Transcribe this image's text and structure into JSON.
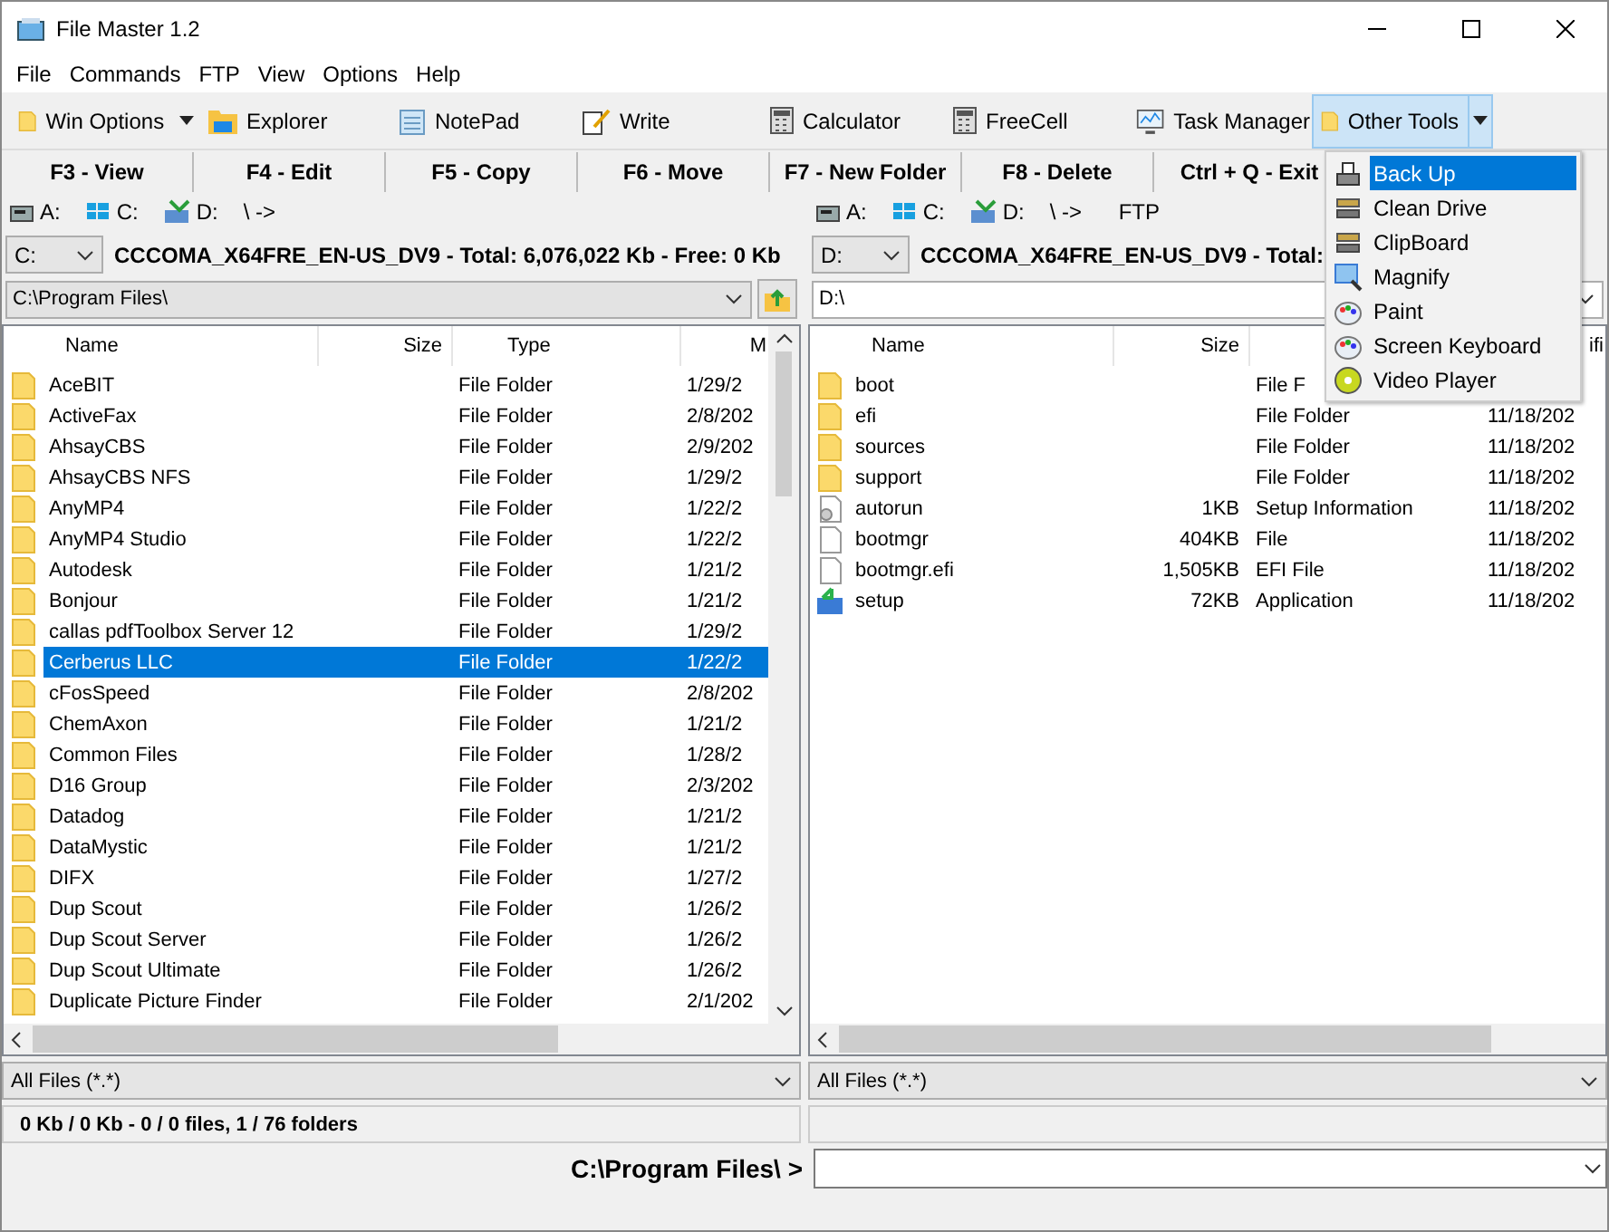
{
  "window": {
    "title": "File Master 1.2"
  },
  "menu": [
    "File",
    "Commands",
    "FTP",
    "View",
    "Options",
    "Help"
  ],
  "toolbar": [
    {
      "label": "Win Options",
      "dropdown": true,
      "selected": false
    },
    {
      "label": "Explorer",
      "dropdown": false,
      "selected": false
    },
    {
      "label": "NotePad",
      "dropdown": false,
      "selected": false
    },
    {
      "label": "Write",
      "dropdown": false,
      "selected": false
    },
    {
      "label": "Calculator",
      "dropdown": false,
      "selected": false
    },
    {
      "label": "FreeCell",
      "dropdown": false,
      "selected": false
    },
    {
      "label": "Task Manager",
      "dropdown": false,
      "selected": false
    },
    {
      "label": "Other Tools",
      "dropdown": true,
      "selected": true
    }
  ],
  "function_keys": [
    "F3 - View",
    "F4 - Edit",
    "F5 - Copy",
    "F6 - Move",
    "F7 - New Folder",
    "F8 - Delete",
    "Ctrl + Q - Exit"
  ],
  "panes": [
    {
      "drives": [
        "A:",
        "C:",
        "D:",
        "\\ ->"
      ],
      "drive_select": "C:",
      "volume_info": "CCCOMA_X64FRE_EN-US_DV9 - Total: 6,076,022 Kb - Free: 0 Kb",
      "path": "C:\\Program Files\\",
      "columns": [
        {
          "label": "Name"
        },
        {
          "label": "Size"
        },
        {
          "label": "Type"
        },
        {
          "label": "M"
        }
      ],
      "rows": [
        {
          "name": "AceBIT",
          "type": "File Folder",
          "modified": "1/29/2",
          "kind": "folder",
          "selected": false
        },
        {
          "name": "ActiveFax",
          "type": "File Folder",
          "modified": "2/8/202",
          "kind": "folder",
          "selected": false
        },
        {
          "name": "AhsayCBS",
          "type": "File Folder",
          "modified": "2/9/202",
          "kind": "folder",
          "selected": false
        },
        {
          "name": "AhsayCBS NFS",
          "type": "File Folder",
          "modified": "1/29/2",
          "kind": "folder",
          "selected": false
        },
        {
          "name": "AnyMP4",
          "type": "File Folder",
          "modified": "1/22/2",
          "kind": "folder",
          "selected": false
        },
        {
          "name": "AnyMP4 Studio",
          "type": "File Folder",
          "modified": "1/22/2",
          "kind": "folder",
          "selected": false
        },
        {
          "name": "Autodesk",
          "type": "File Folder",
          "modified": "1/21/2",
          "kind": "folder",
          "selected": false
        },
        {
          "name": "Bonjour",
          "type": "File Folder",
          "modified": "1/21/2",
          "kind": "folder",
          "selected": false
        },
        {
          "name": "callas pdfToolbox Server 12",
          "type": "File Folder",
          "modified": "1/29/2",
          "kind": "folder",
          "selected": false
        },
        {
          "name": "Cerberus LLC",
          "type": "File Folder",
          "modified": "1/22/2",
          "kind": "folder",
          "selected": true
        },
        {
          "name": "cFosSpeed",
          "type": "File Folder",
          "modified": "2/8/202",
          "kind": "folder",
          "selected": false
        },
        {
          "name": "ChemAxon",
          "type": "File Folder",
          "modified": "1/21/2",
          "kind": "folder",
          "selected": false
        },
        {
          "name": "Common Files",
          "type": "File Folder",
          "modified": "1/28/2",
          "kind": "folder",
          "selected": false
        },
        {
          "name": "D16 Group",
          "type": "File Folder",
          "modified": "2/3/202",
          "kind": "folder",
          "selected": false
        },
        {
          "name": "Datadog",
          "type": "File Folder",
          "modified": "1/21/2",
          "kind": "folder",
          "selected": false
        },
        {
          "name": "DataMystic",
          "type": "File Folder",
          "modified": "1/21/2",
          "kind": "folder",
          "selected": false
        },
        {
          "name": "DIFX",
          "type": "File Folder",
          "modified": "1/27/2",
          "kind": "folder",
          "selected": false
        },
        {
          "name": "Dup Scout",
          "type": "File Folder",
          "modified": "1/26/2",
          "kind": "folder",
          "selected": false
        },
        {
          "name": "Dup Scout Server",
          "type": "File Folder",
          "modified": "1/26/2",
          "kind": "folder",
          "selected": false
        },
        {
          "name": "Dup Scout Ultimate",
          "type": "File Folder",
          "modified": "1/26/2",
          "kind": "folder",
          "selected": false
        },
        {
          "name": "Duplicate Picture Finder",
          "type": "File Folder",
          "modified": "2/1/202",
          "kind": "folder",
          "selected": false
        }
      ],
      "filter": "All Files (*.*)",
      "status": "0 Kb / 0 Kb - 0 / 0 files, 1 / 76 folders"
    },
    {
      "drives": [
        "A:",
        "C:",
        "D:",
        "\\ ->",
        "FTP"
      ],
      "drive_select": "D:",
      "volume_info": "CCCOMA_X64FRE_EN-US_DV9 - Total:",
      "path": "D:\\",
      "columns": [
        {
          "label": "Name"
        },
        {
          "label": "Size"
        },
        {},
        {
          "label": "ifi"
        }
      ],
      "rows": [
        {
          "name": "boot",
          "type": "File F",
          "kind": "folder",
          "selected": false
        },
        {
          "name": "efi",
          "type": "File Folder",
          "modified": "11/18/202",
          "kind": "folder",
          "selected": false
        },
        {
          "name": "sources",
          "type": "File Folder",
          "modified": "11/18/202",
          "kind": "folder",
          "selected": false
        },
        {
          "name": "support",
          "type": "File Folder",
          "modified": "11/18/202",
          "kind": "folder",
          "selected": false
        },
        {
          "name": "autorun",
          "size": "1KB",
          "type": "Setup Information",
          "modified": "11/18/202",
          "kind": "settings",
          "selected": false
        },
        {
          "name": "bootmgr",
          "size": "404KB",
          "type": "File",
          "modified": "11/18/202",
          "kind": "file",
          "selected": false
        },
        {
          "name": "bootmgr.efi",
          "size": "1,505KB",
          "type": "EFI File",
          "modified": "11/18/202",
          "kind": "file",
          "selected": false
        },
        {
          "name": "setup",
          "size": "72KB",
          "type": "Application",
          "modified": "11/18/202",
          "kind": "app",
          "selected": false
        }
      ],
      "filter": "All Files (*.*)"
    }
  ],
  "command": {
    "prompt": "C:\\Program Files\\ >"
  },
  "tools_menu": [
    {
      "label": "Back Up",
      "selected": true
    },
    {
      "label": "Clean Drive",
      "selected": false
    },
    {
      "label": "ClipBoard",
      "selected": false
    },
    {
      "label": "Magnify",
      "selected": false
    },
    {
      "label": "Paint",
      "selected": false
    },
    {
      "label": "Screen Keyboard",
      "selected": false
    },
    {
      "label": "Video Player",
      "selected": false
    }
  ]
}
